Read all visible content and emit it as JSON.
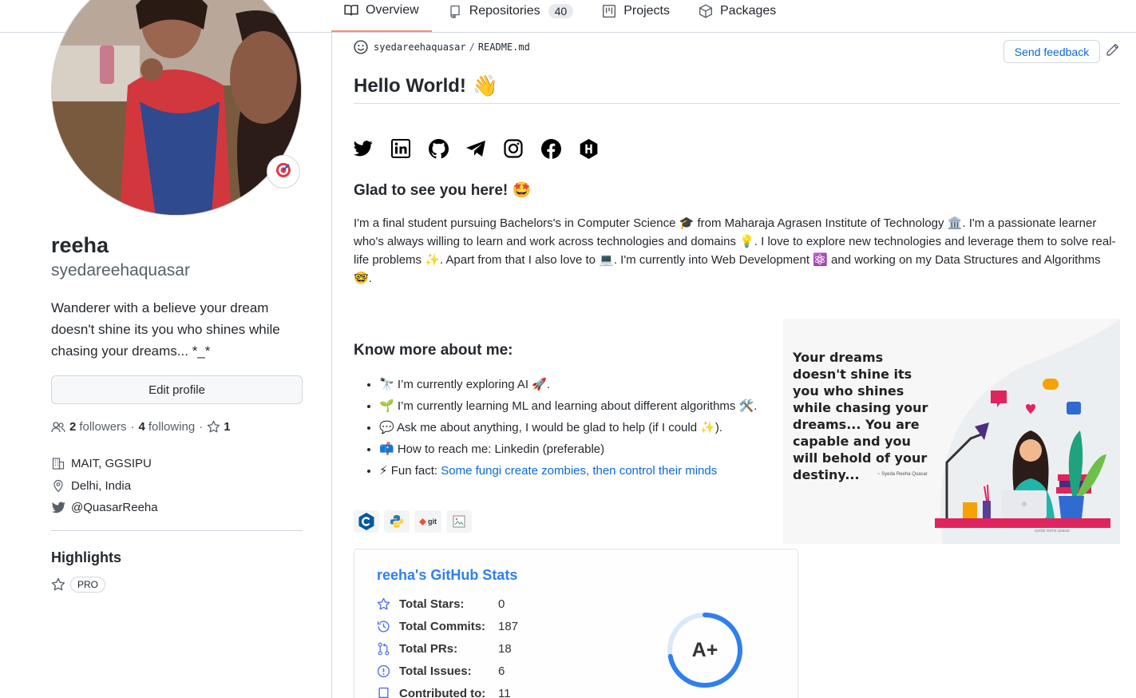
{
  "tabs": [
    {
      "label": "Overview",
      "icon": "book-icon",
      "active": true
    },
    {
      "label": "Repositories",
      "icon": "repo-icon",
      "count": "40"
    },
    {
      "label": "Projects",
      "icon": "project-icon"
    },
    {
      "label": "Packages",
      "icon": "package-icon"
    }
  ],
  "profile": {
    "name": "reeha",
    "login": "syedareehaquasar",
    "bio": "Wanderer with a believe your dream doesn't shine its you who shines while chasing your dreams... *_*",
    "edit_label": "Edit profile",
    "followers_count": "2",
    "followers_label": "followers",
    "following_count": "4",
    "following_label": "following",
    "stars_count": "1",
    "company": "MAIT, GGSIPU",
    "location": "Delhi, India",
    "twitter": "@QuasarReeha",
    "highlights_title": "Highlights",
    "pro_label": "PRO"
  },
  "readme": {
    "owner": "syedareehaquasar",
    "file": "README.md",
    "feedback_label": "Send feedback",
    "title": "Hello World!",
    "title_emoji": "👋",
    "glad_heading": "Glad to see you here!",
    "glad_emoji": "🤩",
    "intro": "I'm a final student pursuing Bachelors's in Computer Science 🎓 from Maharaja Agrasen Institute of Technology 🏛️. I'm a passionate learner who's always willing to learn and work across technologies and domains 💡. I love to explore new technologies and leverage them to solve real-life problems ✨. Apart from that I also love to 💻. I'm currently into Web Development ⚛️ and working on my Data Structures and Algorithms 🤓.",
    "know_more_heading": "Know more about me:",
    "bullets": [
      "🔭 I’m currently exploring AI 🚀.",
      "🌱 I’m currently learning ML and learning about different algorithms 🛠️.",
      "💬 Ask me about anything, I would be glad to help (if I could ✨).",
      "📫 How to reach me: Linkedin (preferable)"
    ],
    "fun_fact_prefix": "⚡ Fun fact: ",
    "fun_fact_link": "Some fungi create zombies, then control their minds",
    "tech_git_label": "git",
    "quote": "Your dreams doesn't shine its you who shines while chasing your dreams... You are capable and you will behold of your destiny...",
    "quote_signature": "~ Syeda Reeha Quasar",
    "quote_footer": "syeda reeha quasar"
  },
  "stats": {
    "title": "reeha's GitHub Stats",
    "rows": [
      {
        "label": "Total Stars:",
        "value": "0",
        "icon": "star-icon"
      },
      {
        "label": "Total Commits:",
        "value": "187",
        "icon": "history-icon"
      },
      {
        "label": "Total PRs:",
        "value": "18",
        "icon": "pull-request-icon"
      },
      {
        "label": "Total Issues:",
        "value": "6",
        "icon": "issue-icon"
      },
      {
        "label": "Contributed to:",
        "value": "11",
        "icon": "repo-icon"
      }
    ],
    "grade": "A+",
    "grade_progress": 0.72
  },
  "colors": {
    "accent": "#0969da",
    "tab_underline": "#fd8c73",
    "stats_blue": "#2f80ed"
  }
}
